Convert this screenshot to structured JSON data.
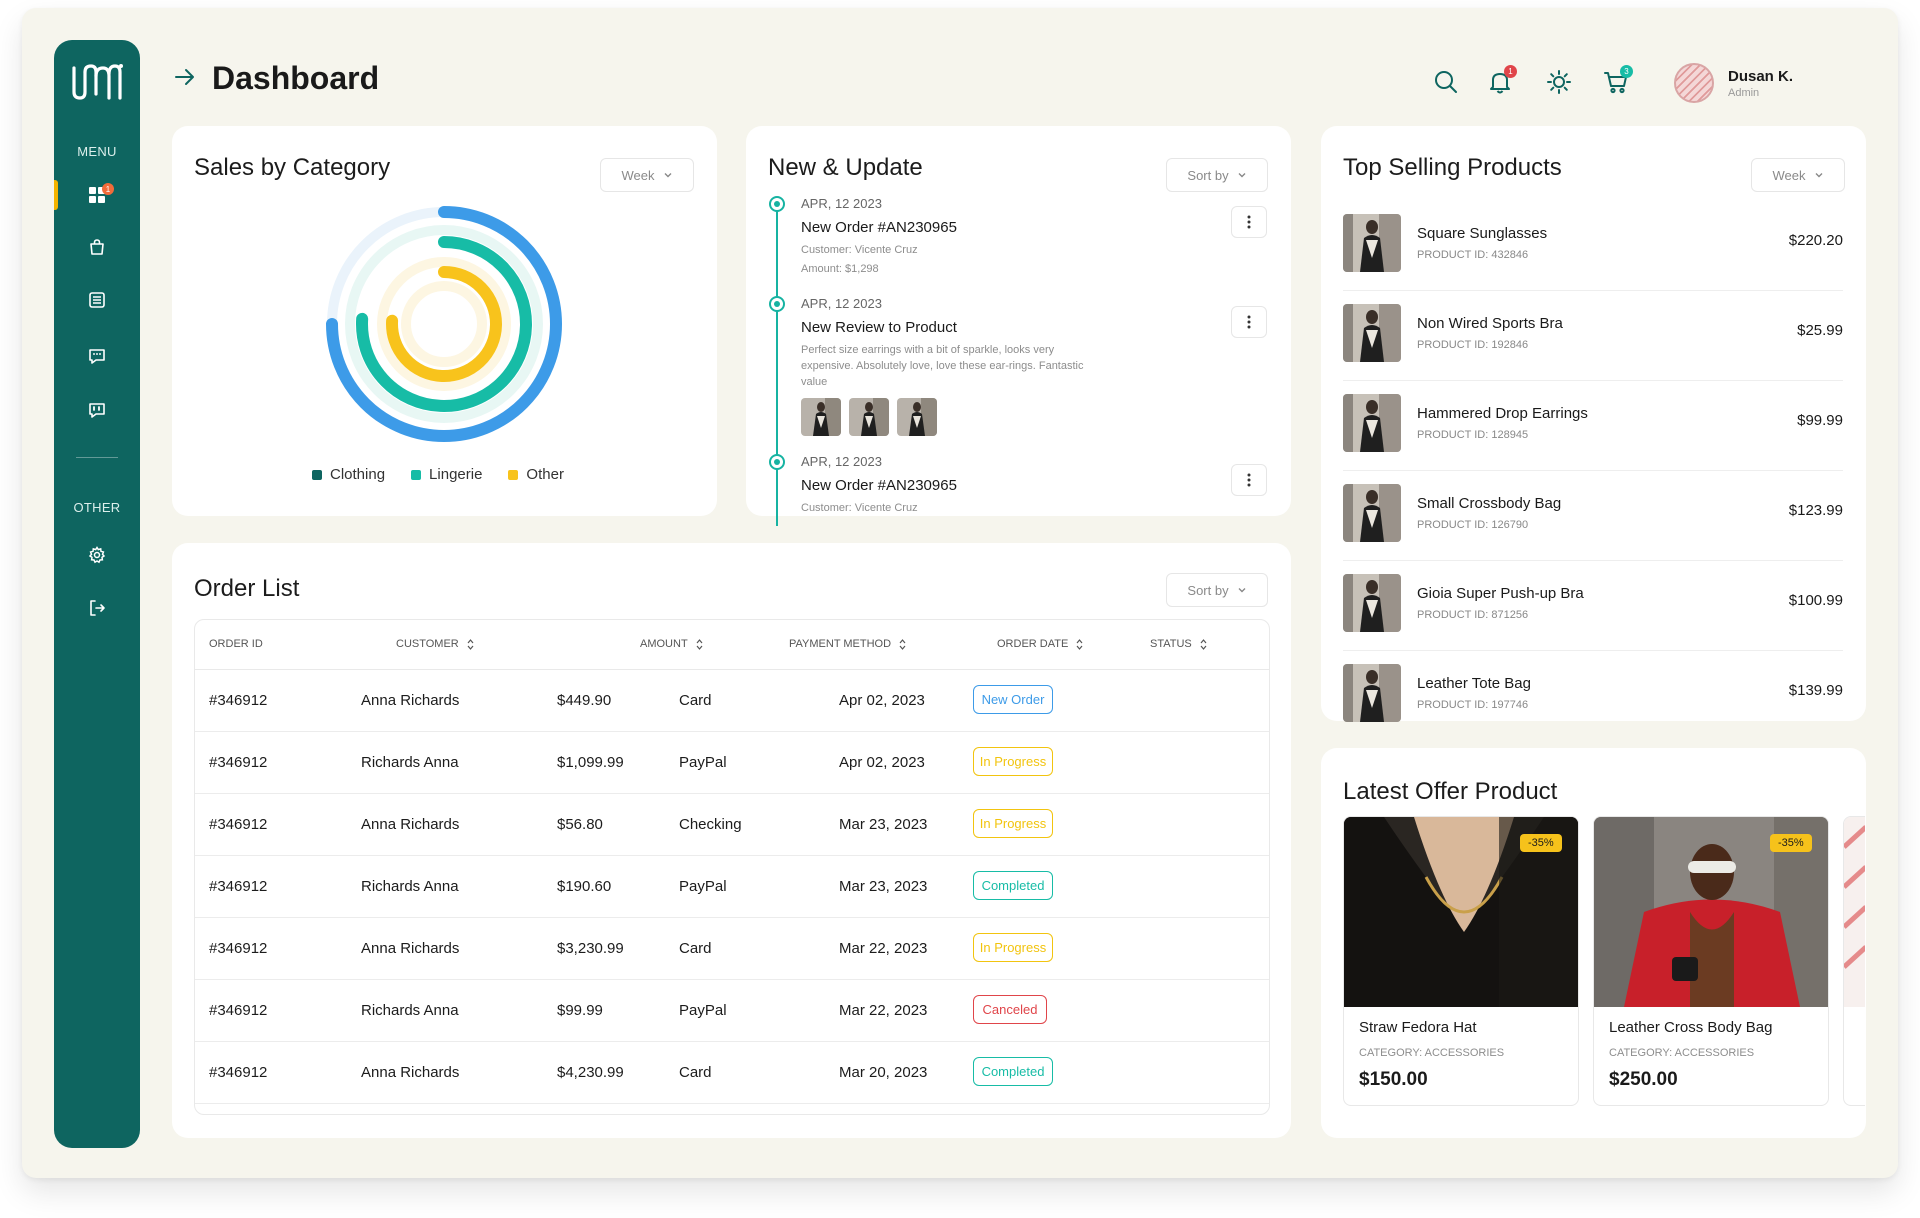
{
  "sidebar": {
    "menu_label": "MENU",
    "other_label": "OTHER",
    "dashboard_badge": "1",
    "items": [
      {
        "name": "dashboard",
        "icon": "dashboard-icon"
      },
      {
        "name": "products",
        "icon": "shopping-bag-icon"
      },
      {
        "name": "orders",
        "icon": "list-icon"
      },
      {
        "name": "messages",
        "icon": "chat-icon"
      },
      {
        "name": "reviews",
        "icon": "chat-quote-icon"
      },
      {
        "name": "settings",
        "icon": "gear-icon"
      },
      {
        "name": "logout",
        "icon": "logout-icon"
      }
    ]
  },
  "header": {
    "title": "Dashboard",
    "notification_count": "1",
    "cart_count": "3",
    "user": {
      "name": "Dusan K.",
      "role": "Admin"
    }
  },
  "sales_by_category": {
    "title": "Sales by Category",
    "period": "Week",
    "legend": [
      {
        "label": "Clothing",
        "color": "#0e6560",
        "value": 0.75
      },
      {
        "label": "Lingerie",
        "color": "#17bca6",
        "value": 0.76
      },
      {
        "label": "Other",
        "color": "#f8c31c",
        "value": 0.76
      }
    ],
    "outer_ring": {
      "color": "#3d9be8",
      "value": 0.75
    }
  },
  "news": {
    "title": "New & Update",
    "sort_label": "Sort by",
    "entries": [
      {
        "date": "APR, 12 2023",
        "title": "New Order #AN230965",
        "line1": "Customer: Vicente Cruz",
        "line2": "Amount: $1,298"
      },
      {
        "date": "APR, 12 2023",
        "title": "New Review to Product",
        "line1": "Perfect size earrings with a bit of sparkle, looks very expensive. Absolutely love, love these ear-rings. Fantastic value"
      },
      {
        "date": "APR, 12 2023",
        "title": "New Order #AN230965",
        "line1": "Customer: Vicente Cruz"
      }
    ]
  },
  "orders": {
    "title": "Order List",
    "sort_label": "Sort by",
    "columns": [
      "ORDER ID",
      "CUSTOMER",
      "AMOUNT",
      "PAYMENT METHOD",
      "ORDER DATE",
      "STATUS"
    ],
    "rows": [
      {
        "id": "#346912",
        "customer": "Anna Richards",
        "amount": "$449.90",
        "method": "Card",
        "date": "Apr 02, 2023",
        "status": "New Order",
        "status_color": "#3d9be8"
      },
      {
        "id": "#346912",
        "customer": "Richards Anna",
        "amount": "$1,099.99",
        "method": "PayPal",
        "date": "Apr 02, 2023",
        "status": "In Progress",
        "status_color": "#f2c40f"
      },
      {
        "id": "#346912",
        "customer": "Anna Richards",
        "amount": "$56.80",
        "method": "Checking",
        "date": "Mar 23, 2023",
        "status": "In Progress",
        "status_color": "#f2c40f"
      },
      {
        "id": "#346912",
        "customer": "Richards Anna",
        "amount": "$190.60",
        "method": "PayPal",
        "date": "Mar 23, 2023",
        "status": "Completed",
        "status_color": "#17bca6"
      },
      {
        "id": "#346912",
        "customer": "Anna Richards",
        "amount": "$3,230.99",
        "method": "Card",
        "date": "Mar 22, 2023",
        "status": "In Progress",
        "status_color": "#f2c40f"
      },
      {
        "id": "#346912",
        "customer": "Richards Anna",
        "amount": "$99.99",
        "method": "PayPal",
        "date": "Mar 22, 2023",
        "status": "Canceled",
        "status_color": "#e0454a"
      },
      {
        "id": "#346912",
        "customer": "Anna Richards",
        "amount": "$4,230.99",
        "method": "Card",
        "date": "Mar 20, 2023",
        "status": "Completed",
        "status_color": "#17bca6"
      }
    ]
  },
  "top_selling": {
    "title": "Top Selling Products",
    "period": "Week",
    "products": [
      {
        "name": "Square Sunglasses",
        "id": "PRODUCT ID: 432846",
        "price": "$220.20"
      },
      {
        "name": "Non Wired Sports Bra",
        "id": "PRODUCT ID: 192846",
        "price": "$25.99"
      },
      {
        "name": "Hammered Drop Earrings",
        "id": "PRODUCT ID: 128945",
        "price": "$99.99"
      },
      {
        "name": "Small Crossbody Bag",
        "id": "PRODUCT ID: 126790",
        "price": "$123.99"
      },
      {
        "name": "Gioia Super Push-up Bra",
        "id": "PRODUCT ID: 871256",
        "price": "$100.99"
      },
      {
        "name": "Leather Tote Bag",
        "id": "PRODUCT ID: 197746",
        "price": "$139.99"
      }
    ]
  },
  "latest_offer": {
    "title": "Latest Offer Product",
    "offers": [
      {
        "name": "Straw Fedora Hat",
        "category": "CATEGORY: ACCESSORIES",
        "price": "$150.00",
        "discount": "-35%"
      },
      {
        "name": "Leather Cross Body Bag",
        "category": "CATEGORY: ACCESSORIES",
        "price": "$250.00",
        "discount": "-35%"
      }
    ]
  },
  "colors": {
    "primary": "#0e6560",
    "teal": "#17bca6",
    "blue": "#3d9be8",
    "yellow": "#f8c31c",
    "red": "#e0454a",
    "background": "#f6f5ed"
  }
}
